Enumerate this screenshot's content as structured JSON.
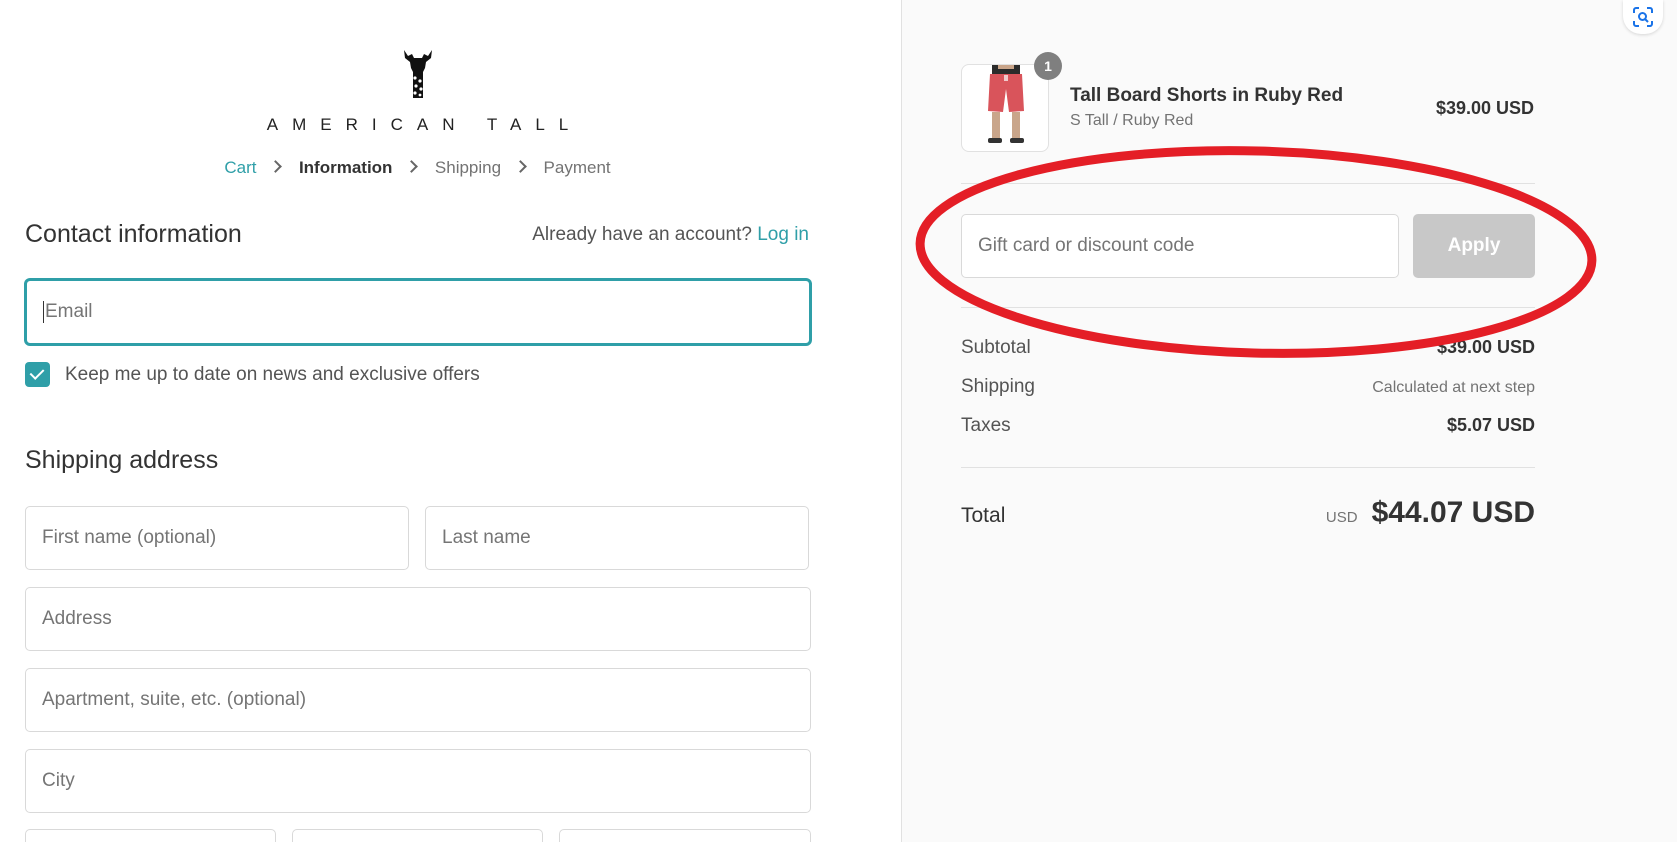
{
  "brand": {
    "name": "AMERICAN TALL"
  },
  "breadcrumb": {
    "items": [
      {
        "label": "Cart"
      },
      {
        "label": "Information"
      },
      {
        "label": "Shipping"
      },
      {
        "label": "Payment"
      }
    ]
  },
  "contact": {
    "title": "Contact information",
    "account_prompt": "Already have an account?",
    "login_label": "Log in",
    "email_placeholder": "Email",
    "newsletter_label": "Keep me up to date on news and exclusive offers"
  },
  "shipping": {
    "title": "Shipping address",
    "first_name_placeholder": "First name (optional)",
    "last_name_placeholder": "Last name",
    "address_placeholder": "Address",
    "apartment_placeholder": "Apartment, suite, etc. (optional)",
    "city_placeholder": "City"
  },
  "order": {
    "item": {
      "name": "Tall Board Shorts in Ruby Red",
      "variant": "S Tall / Ruby Red",
      "price": "$39.00 USD",
      "quantity": "1"
    },
    "discount": {
      "placeholder": "Gift card or discount code",
      "apply_label": "Apply"
    },
    "summary": {
      "subtotal_label": "Subtotal",
      "subtotal_value": "$39.00 USD",
      "shipping_label": "Shipping",
      "shipping_value": "Calculated at next step",
      "taxes_label": "Taxes",
      "taxes_value": "$5.07 USD",
      "total_label": "Total",
      "total_currency": "USD",
      "total_value": "$44.07 USD"
    }
  },
  "colors": {
    "accent": "#2f9fa8",
    "annotation": "#e41e26",
    "apply_disabled": "#c8c8c8",
    "sidebar_bg": "#fafafa"
  }
}
